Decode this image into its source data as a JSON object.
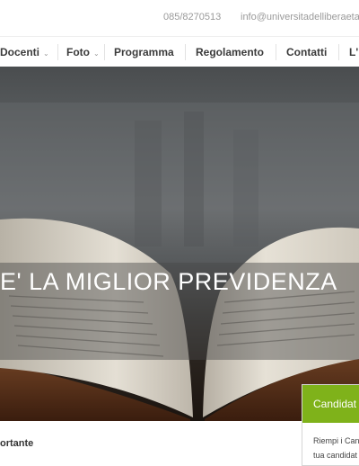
{
  "topbar": {
    "phone": "085/8270513",
    "email": "info@universitadelliberaeta"
  },
  "nav": {
    "items": [
      {
        "label": "Docenti",
        "has_dropdown": true
      },
      {
        "label": "Foto",
        "has_dropdown": true
      },
      {
        "label": "Programma",
        "has_dropdown": false
      },
      {
        "label": "Regolamento",
        "has_dropdown": false
      },
      {
        "label": "Contatti",
        "has_dropdown": false
      },
      {
        "label": "L'",
        "has_dropdown": false
      }
    ]
  },
  "hero": {
    "headline": "E' LA MIGLIOR PREVIDENZA"
  },
  "bottom": {
    "label": "ortante"
  },
  "widget": {
    "title": "Candidat",
    "line1": "Riempi i Can",
    "line2": "tua candidat"
  },
  "colors": {
    "accent": "#7fb21a",
    "nav_text": "#3b3b3b",
    "topbar_text": "#9a9a9a"
  }
}
